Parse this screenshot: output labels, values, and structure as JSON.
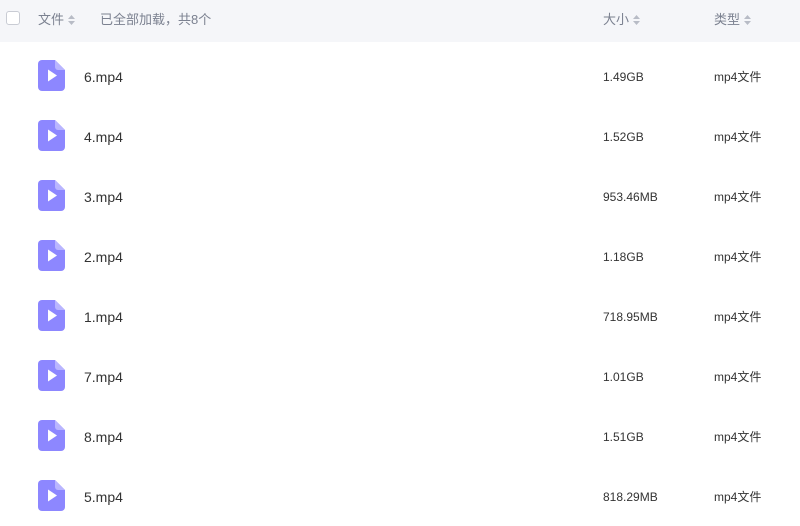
{
  "header": {
    "col_file": "文件",
    "loaded_status": "已全部加载，共8个",
    "col_size": "大小",
    "col_type": "类型"
  },
  "colors": {
    "header_bg": "#f5f6f9",
    "icon_color": "#8d87ff",
    "header_text": "#7b8190"
  },
  "files": [
    {
      "name": "6.mp4",
      "size": "1.49GB",
      "type": "mp4文件",
      "icon": "video-file-icon"
    },
    {
      "name": "4.mp4",
      "size": "1.52GB",
      "type": "mp4文件",
      "icon": "video-file-icon"
    },
    {
      "name": "3.mp4",
      "size": "953.46MB",
      "type": "mp4文件",
      "icon": "video-file-icon"
    },
    {
      "name": "2.mp4",
      "size": "1.18GB",
      "type": "mp4文件",
      "icon": "video-file-icon"
    },
    {
      "name": "1.mp4",
      "size": "718.95MB",
      "type": "mp4文件",
      "icon": "video-file-icon"
    },
    {
      "name": "7.mp4",
      "size": "1.01GB",
      "type": "mp4文件",
      "icon": "video-file-icon"
    },
    {
      "name": "8.mp4",
      "size": "1.51GB",
      "type": "mp4文件",
      "icon": "video-file-icon"
    },
    {
      "name": "5.mp4",
      "size": "818.29MB",
      "type": "mp4文件",
      "icon": "video-file-icon"
    }
  ]
}
